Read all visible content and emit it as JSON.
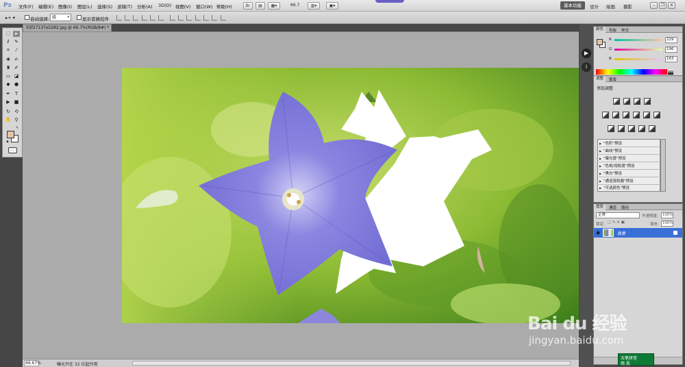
{
  "app": {
    "logo": "Ps",
    "menus": [
      "文件(F)",
      "编辑(E)",
      "图像(I)",
      "图层(L)",
      "选择(S)",
      "滤镜(T)",
      "分析(A)",
      "3D(D)",
      "视图(V)",
      "窗口(W)",
      "帮助(H)"
    ],
    "zoom_value": "66.7",
    "workspaces": {
      "active": "基本功能",
      "items": [
        "设计",
        "绘画",
        "摄影"
      ]
    }
  },
  "options": {
    "auto_select_label": "自动选择:",
    "auto_select_value": "组",
    "show_transform_label": "显示变换控件"
  },
  "document": {
    "tab_title": "55f27137e5282.jpg @ 66.7%(RGB/8#) *"
  },
  "status": {
    "zoom": "66.67%",
    "info": "曝光只在 32 位起作用"
  },
  "color_panel": {
    "tabs": [
      "颜色",
      "色板",
      "样式"
    ],
    "fg_color": "#e5c4a3",
    "bg_color": "#ffffff",
    "R": {
      "label": "R",
      "value": "229"
    },
    "G": {
      "label": "G",
      "value": "196"
    },
    "B": {
      "label": "B",
      "value": "163"
    }
  },
  "adjust_panel": {
    "tabs": [
      "调整",
      "蒙版"
    ],
    "title": "添加调整",
    "presets": [
      "\"色阶\"预设",
      "\"曲线\"预设",
      "\"曝光度\"预设",
      "\"色相/饱和度\"预设",
      "\"黑白\"预设",
      "\"通道混和器\"预设",
      "\"可选颜色\"预设"
    ]
  },
  "layers_panel": {
    "tabs": [
      "图层",
      "通道",
      "路径"
    ],
    "blend_mode": "正常",
    "opacity_label": "不透明度:",
    "opacity_value": "100%",
    "lock_label": "锁定:",
    "fill_label": "填充:",
    "fill_value": "100%",
    "layer_name": "背景"
  },
  "ime": {
    "line1": "五笔拼音",
    "line2": "简 英"
  },
  "watermark": {
    "brand": "Bai du 经验",
    "url": "jingyan.baidu.com"
  }
}
